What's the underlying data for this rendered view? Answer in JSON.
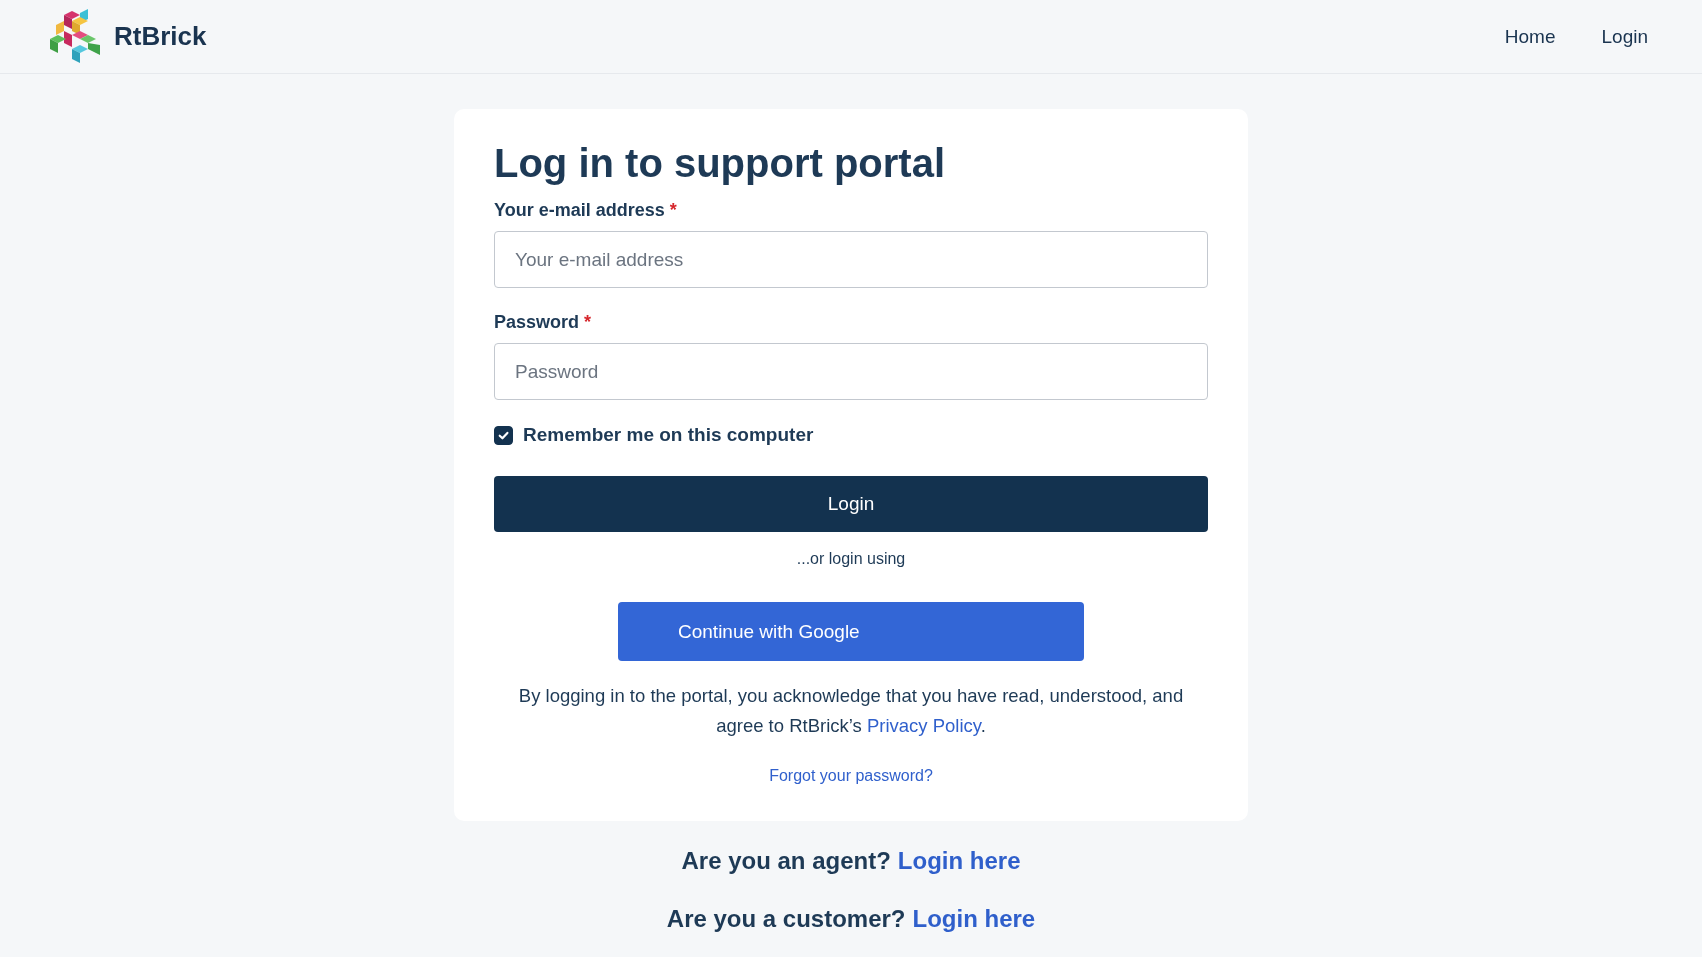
{
  "header": {
    "brand": "RtBrick",
    "nav": [
      {
        "label": "Home"
      },
      {
        "label": "Login"
      }
    ]
  },
  "card": {
    "title": "Log in to support portal",
    "fields": [
      {
        "label": "Your e-mail address",
        "required_mark": "*",
        "placeholder": "Your e-mail address"
      },
      {
        "label": "Password",
        "required_mark": "*",
        "placeholder": "Password"
      }
    ],
    "remember": {
      "label": "Remember me on this computer",
      "checked": true
    },
    "login_button": "Login",
    "alt_text": "...or login using",
    "google_button": "Continue with Google",
    "notice": {
      "before": "By logging in to the portal, you acknowledge that you have read, understood, and agree to RtBrick’s",
      "link": "Privacy Policy",
      "after": "."
    },
    "forgot_link": "Forgot your password?"
  },
  "footer_lines": [
    {
      "question": "Are you an agent?",
      "link": "Login here"
    },
    {
      "question": "Are you a customer?",
      "link": "Login here"
    }
  ]
}
